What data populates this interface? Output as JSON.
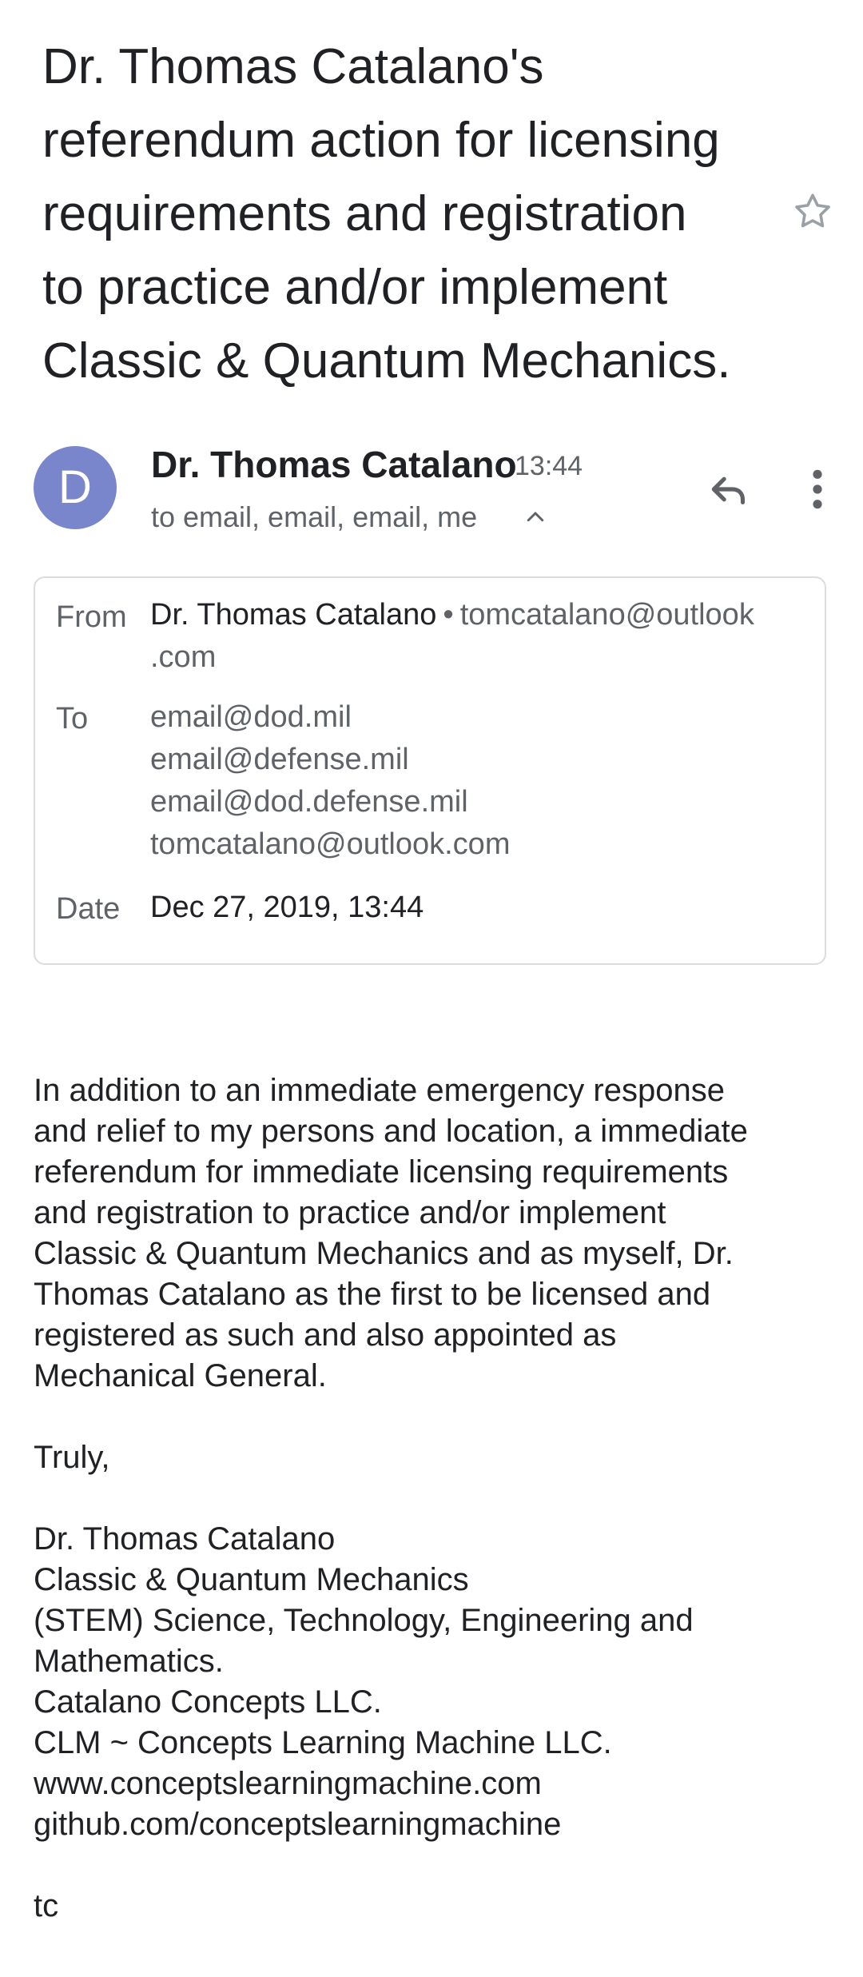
{
  "subject": {
    "lines": [
      "Dr. Thomas Catalano's",
      "referendum action for licensing",
      "requirements and registration",
      "to practice and/or implement",
      "Classic & Quantum Mechanics."
    ],
    "star_icon": "star-outline-icon"
  },
  "header": {
    "avatar_letter": "D",
    "avatar_color": "#7986cb",
    "sender_name": "Dr. Thomas Catalano",
    "time": "13:44",
    "recipients_summary": "to email, email, email, me",
    "reply_icon": "reply-icon",
    "more_icon": "more-vert-icon"
  },
  "details": {
    "from_label": "From",
    "from_name": "Dr. Thomas Catalano",
    "from_email_line1": "tomcatalano@outlook",
    "from_email_line2": ".com",
    "to_label": "To",
    "to": [
      "email@dod.mil",
      "email@defense.mil",
      "email@dod.defense.mil",
      "tomcatalano@outlook.com"
    ],
    "date_label": "Date",
    "date_value": "Dec 27, 2019, 13:44"
  },
  "body": {
    "paragraph_lines": [
      "In addition to an immediate emergency response",
      "and relief to my persons and location, a immediate",
      "referendum for immediate licensing requirements",
      "and registration to practice and/or implement",
      "Classic & Quantum Mechanics and as myself, Dr.",
      "Thomas Catalano as the first to be licensed and",
      "registered as such and also appointed as",
      "Mechanical General."
    ],
    "closing": "Truly,",
    "signature_lines": [
      "Dr. Thomas Catalano",
      "Classic & Quantum Mechanics",
      "(STEM) Science, Technology, Engineering and",
      "Mathematics.",
      "Catalano Concepts LLC.",
      "CLM ~ Concepts Learning Machine LLC.",
      "www.conceptslearningmachine.com",
      "github.com/conceptslearningmachine"
    ],
    "initials": "tc"
  }
}
